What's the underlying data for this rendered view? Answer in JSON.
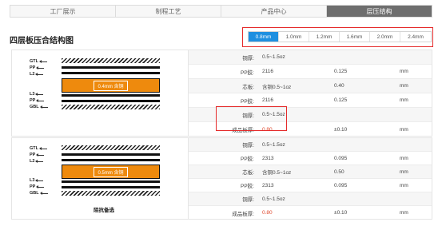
{
  "tabs": [
    {
      "label": "工厂展示",
      "active": false
    },
    {
      "label": "制程工艺",
      "active": false
    },
    {
      "label": "产品中心",
      "active": false
    },
    {
      "label": "层压结构",
      "active": true
    }
  ],
  "page_title": "四层板压合结构图",
  "thickness_options": [
    "0.8mm",
    "1.0mm",
    "1.2mm",
    "1.6mm",
    "2.0mm",
    "2.4mm"
  ],
  "selected_thickness": "0.8mm",
  "layer_labels": [
    "GTL",
    "PP",
    "L2",
    "L3",
    "PP",
    "GBL"
  ],
  "structures": [
    {
      "core_tag": "0.4mm 含铜",
      "caption": "",
      "rows": [
        {
          "label": "铜厚:",
          "v1": "0.5~1.5oz",
          "v2": "",
          "unit": ""
        },
        {
          "label": "PP胶:",
          "v1": "2116",
          "v2": "0.125",
          "unit": "mm"
        },
        {
          "label": "芯板:",
          "v1": "含铜0.5~1oz",
          "v2": "0.40",
          "unit": "mm"
        },
        {
          "label": "PP胶:",
          "v1": "2116",
          "v2": "0.125",
          "unit": "mm"
        },
        {
          "label": "铜厚:",
          "v1": "0.5~1.5oz",
          "v2": "",
          "unit": ""
        },
        {
          "label": "成品板厚:",
          "v1": "0.80",
          "v2": "±0.10",
          "unit": "mm"
        }
      ]
    },
    {
      "core_tag": "0.5mm 含铜",
      "caption": "阻抗备选",
      "rows": [
        {
          "label": "铜厚:",
          "v1": "0.5~1.5oz",
          "v2": "",
          "unit": ""
        },
        {
          "label": "PP胶:",
          "v1": "2313",
          "v2": "0.095",
          "unit": "mm"
        },
        {
          "label": "芯板:",
          "v1": "含铜0.5~1oz",
          "v2": "0.50",
          "unit": "mm"
        },
        {
          "label": "PP胶:",
          "v1": "2313",
          "v2": "0.095",
          "unit": "mm"
        },
        {
          "label": "铜厚:",
          "v1": "0.5~1.5oz",
          "v2": "",
          "unit": ""
        },
        {
          "label": "成品板厚:",
          "v1": "0.80",
          "v2": "±0.10",
          "unit": "mm"
        }
      ]
    }
  ],
  "colors": {
    "accent": "#1e8fe0",
    "highlight": "#e52b2b",
    "core": "#ee8a0d",
    "value_red": "#e0452a"
  }
}
